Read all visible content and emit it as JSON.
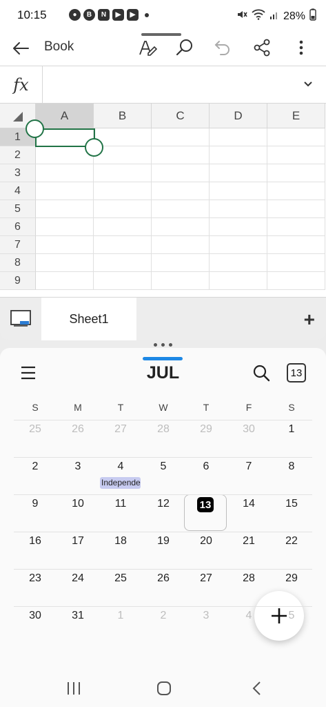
{
  "status_bar": {
    "time": "10:15",
    "battery": "28%",
    "notification_icons": [
      "chat-icon",
      "b-icon",
      "n-icon",
      "youtube-icon",
      "youtube-icon"
    ],
    "notif_letters": [
      "●",
      "B",
      "N",
      "▶",
      "▶"
    ]
  },
  "excel": {
    "title": "Book",
    "formula_label": "fx",
    "formula_value": "",
    "columns": [
      "A",
      "B",
      "C",
      "D",
      "E"
    ],
    "rows": [
      "1",
      "2",
      "3",
      "4",
      "5",
      "6",
      "7",
      "8",
      "9"
    ],
    "selected_cell": "A1",
    "sheet_tab": "Sheet1",
    "add_sheet": "+"
  },
  "calendar": {
    "month": "JUL",
    "today_icon_label": "13",
    "weekdays": [
      "S",
      "M",
      "T",
      "W",
      "T",
      "F",
      "S"
    ],
    "weeks": [
      [
        "25",
        "26",
        "27",
        "28",
        "29",
        "30",
        "1"
      ],
      [
        "2",
        "3",
        "4",
        "5",
        "6",
        "7",
        "8"
      ],
      [
        "9",
        "10",
        "11",
        "12",
        "13",
        "14",
        "15"
      ],
      [
        "16",
        "17",
        "18",
        "19",
        "20",
        "21",
        "22"
      ],
      [
        "23",
        "24",
        "25",
        "26",
        "27",
        "28",
        "29"
      ],
      [
        "30",
        "31",
        "1",
        "2",
        "3",
        "4",
        "5"
      ]
    ],
    "today": "13",
    "event": "Independence Day",
    "fab_label": "+",
    "colors": {
      "accent": "#1e88e5",
      "event_bg": "#c7cbf0",
      "today_bg": "#000000"
    }
  },
  "colors": {
    "excel_green": "#217346"
  }
}
